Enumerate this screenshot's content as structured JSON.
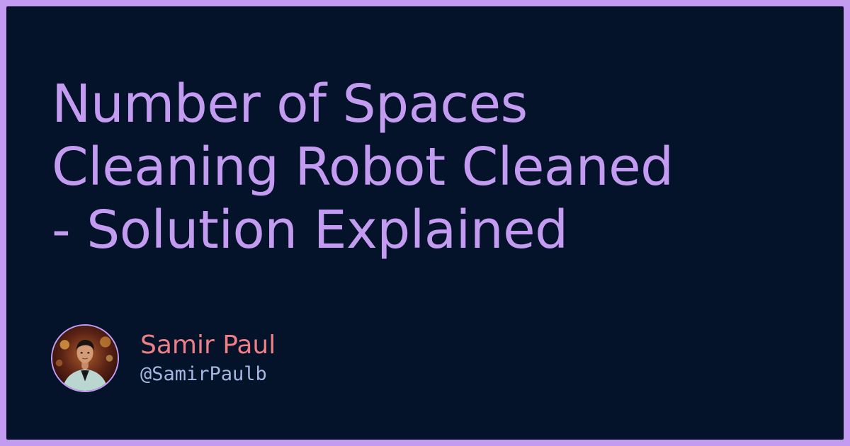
{
  "title": {
    "lines": [
      "Number of Spaces",
      "Cleaning Robot Cleaned",
      "- Solution Explained"
    ]
  },
  "author": {
    "name": "Samir Paul",
    "handle": "@SamirPaulb"
  },
  "colors": {
    "frame": "#c39bf0",
    "background": "#04122a",
    "title": "#c39bf0",
    "author_name": "#ef7f86",
    "author_handle": "#a7b6e3"
  }
}
